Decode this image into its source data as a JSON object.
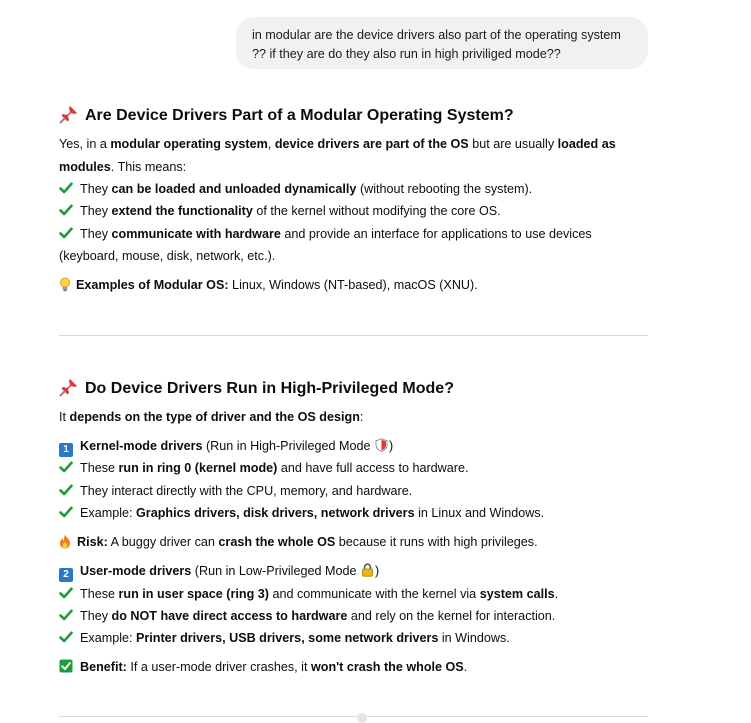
{
  "user_message": {
    "line1": "in modular are the device drivers also part of the operating system",
    "line2": "?? if they are do they also run in high priviliged mode??"
  },
  "section1": {
    "title": "Are Device Drivers Part of a Modular Operating System?",
    "intro": {
      "t1": "Yes, in a ",
      "b1": "modular operating system",
      "t2": ", ",
      "b2": "device drivers are part of the OS",
      "t3": " but are usually ",
      "b3": "loaded as",
      "b4": "modules",
      "t4": ". This means:"
    },
    "points": [
      {
        "t1": "They ",
        "b": "can be loaded and unloaded dynamically",
        "t2": " (without rebooting the system)."
      },
      {
        "t1": "They ",
        "b": "extend the functionality",
        "t2": " of the kernel without modifying the core OS."
      },
      {
        "t1": "They ",
        "b": "communicate with hardware",
        "t2": " and provide an interface for applications to use devices",
        "t3": "(keyboard, mouse, disk, network, etc.)."
      }
    ],
    "examples": {
      "b": "Examples of Modular OS:",
      "t": " Linux, Windows (NT-based), macOS (XNU)."
    }
  },
  "section2": {
    "title": "Do Device Drivers Run in High-Privileged Mode?",
    "intro": {
      "t1": "It ",
      "b": "depends on the type of driver and the OS design",
      "t2": ":"
    },
    "kernel": {
      "num": "1",
      "b": "Kernel-mode drivers",
      "t": " (Run in High-Privileged Mode ",
      "t_end": ")",
      "points": [
        {
          "t1": "These ",
          "b": "run in ring 0 (kernel mode)",
          "t2": " and have full access to hardware."
        },
        {
          "t1": "They interact directly with the CPU, memory, and hardware.",
          "b": "",
          "t2": ""
        },
        {
          "t1": "Example: ",
          "b": "Graphics drivers, disk drivers, network drivers",
          "t2": " in Linux and Windows."
        }
      ]
    },
    "risk": {
      "b1": "Risk:",
      "t1": " A buggy driver can ",
      "b2": "crash the whole OS",
      "t2": " because it runs with high privileges."
    },
    "user": {
      "num": "2",
      "b": "User-mode drivers",
      "t": " (Run in Low-Privileged Mode ",
      "t_end": ")",
      "points": [
        {
          "t1": "These ",
          "b": "run in user space (ring 3)",
          "t2": " and communicate with the kernel via ",
          "b2": "system calls",
          "t3": "."
        },
        {
          "t1": "They ",
          "b": "do NOT have direct access to hardware",
          "t2": " and rely on the kernel for interaction."
        },
        {
          "t1": "Example: ",
          "b": "Printer drivers, USB drivers, some network drivers",
          "t2": " in Windows."
        }
      ]
    },
    "benefit": {
      "b1": "Benefit:",
      "t1": " If a user-mode driver crashes, it ",
      "b2": "won't crash the whole OS",
      "t2": "."
    }
  }
}
